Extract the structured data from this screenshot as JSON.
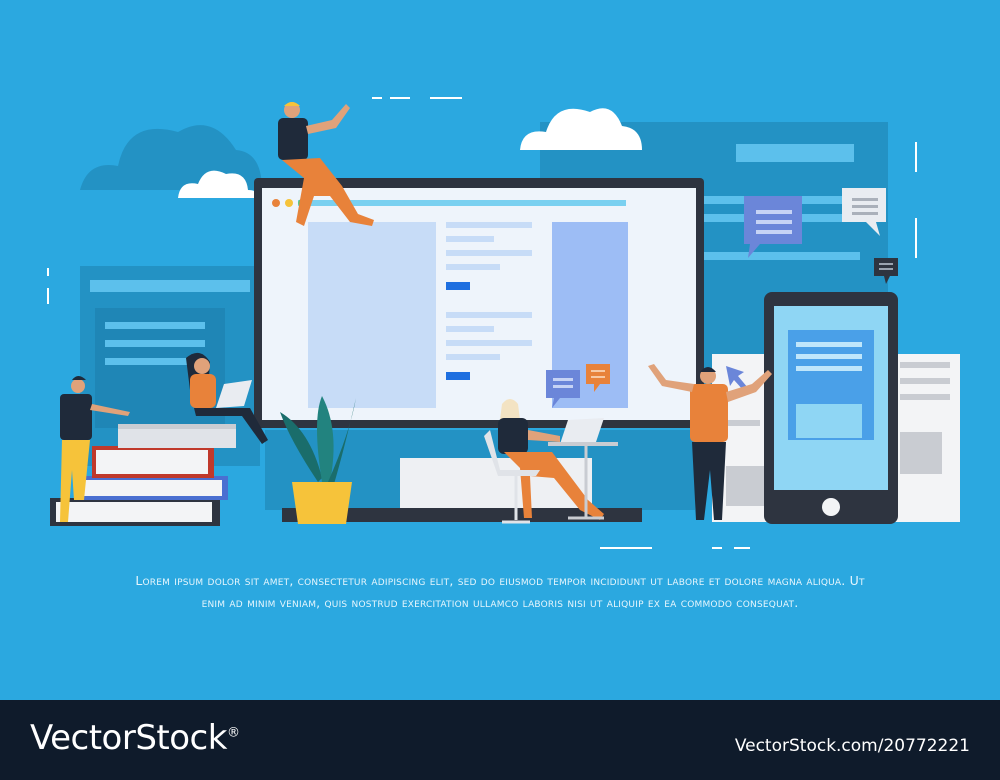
{
  "illustration": {
    "description_icons": [
      "cloud-icon",
      "speech-bubble-icon",
      "cursor-arrow-icon",
      "plant-icon",
      "laptop-icon",
      "smartphone-icon",
      "monitor-icon",
      "book-stack-icon"
    ]
  },
  "caption": {
    "text": "Lorem ipsum dolor sit amet, consectetur adipiscing elit, sed do eiusmod tempor incididunt ut labore et dolore magna aliqua. Ut enim ad minim veniam, quis nostrud exercitation ullamco laboris nisi ut aliquip ex ea commodo consequat."
  },
  "footer": {
    "brand": "VectorStock",
    "registered": "®",
    "image_id": "VectorStock.com/20772221"
  },
  "colors": {
    "background": "#2ba8e0",
    "footer": "#0f1b2b",
    "monitor_frame": "#2e3440",
    "screen": "#eef4fb",
    "accent_blue": "#1e6fe0",
    "orange": "#e8823a",
    "yellow": "#f6c33a"
  }
}
